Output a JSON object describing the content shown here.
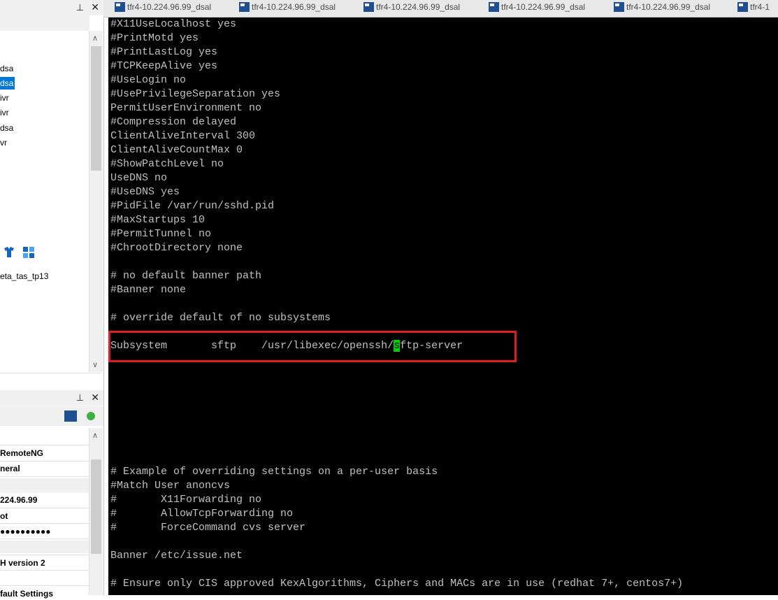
{
  "left_panel": {
    "top_title": {
      "pin": "⊥",
      "close": "✕"
    },
    "tree_items": [
      "dsa",
      "dsa",
      "ivr",
      "ivr",
      "dsa",
      "vr"
    ],
    "selected_index": 1,
    "scroll_up": "∧",
    "scroll_down": "∨",
    "session_label": "eta_tas_tp13",
    "config_title": {
      "pin": "⊥",
      "close": "✕"
    },
    "properties": [
      "RemoteNG",
      "neral",
      "224.96.99",
      "ot",
      "●●●●●●●●●●",
      "H version 2",
      "fault Settings"
    ]
  },
  "tabs": [
    "tfr4-10.224.96.99_dsal",
    "tfr4-10.224.96.99_dsal",
    "tfr4-10.224.96.99_dsal",
    "tfr4-10.224.96.99_dsal",
    "tfr4-10.224.96.99_dsal",
    "tfr4-1"
  ],
  "terminal": {
    "lines": [
      "#X11UseLocalhost yes",
      "#PrintMotd yes",
      "#PrintLastLog yes",
      "#TCPKeepAlive yes",
      "#UseLogin no",
      "#UsePrivilegeSeparation yes",
      "PermitUserEnvironment no",
      "#Compression delayed",
      "ClientAliveInterval 300",
      "ClientAliveCountMax 0",
      "#ShowPatchLevel no",
      "UseDNS no",
      "#UseDNS yes",
      "#PidFile /var/run/sshd.pid",
      "#MaxStartups 10",
      "#PermitTunnel no",
      "#ChrootDirectory none",
      "",
      "# no default banner path",
      "#Banner none",
      "",
      "# override default of no subsystems",
      "",
      "",
      "",
      "",
      "",
      "",
      "",
      "",
      "",
      "",
      "# Example of overriding settings on a per-user basis",
      "#Match User anoncvs",
      "#       X11Forwarding no",
      "#       AllowTcpForwarding no",
      "#       ForceCommand cvs server",
      "",
      "Banner /etc/issue.net",
      "",
      "# Ensure only CIS approved KexAlgorithms, Ciphers and MACs are in use (redhat 7+, centos7+)"
    ],
    "highlight": {
      "before": "Subsystem       sftp    /usr/libexec/openssh/",
      "cursor_char": "s",
      "after": "ftp-server"
    }
  },
  "colors": {
    "terminal_bg": "#000000",
    "terminal_fg": "#c0c0c0",
    "cursor": "#00d000",
    "highlight_box": "#e02020",
    "selection": "#0078d7"
  }
}
